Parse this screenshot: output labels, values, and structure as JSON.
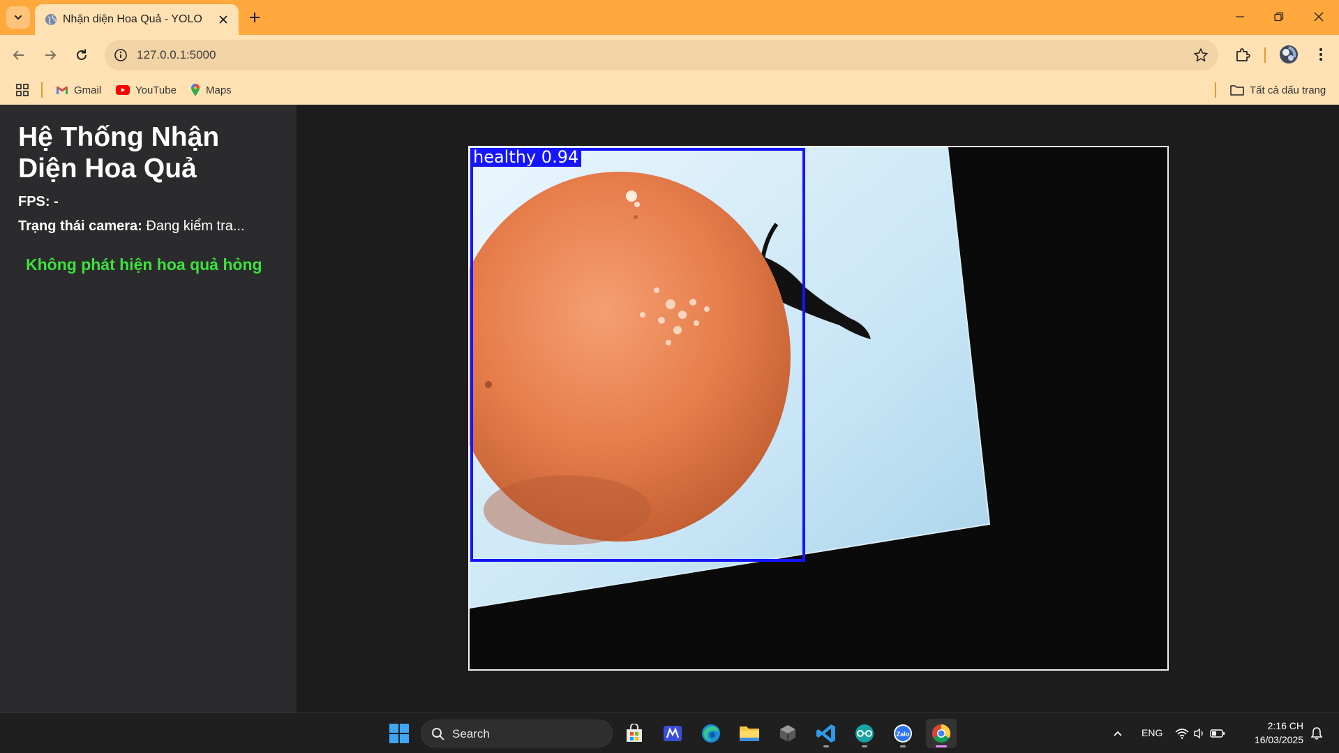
{
  "browser": {
    "tab": {
      "title": "Nhận diện Hoa Quả - YOLO"
    },
    "url": "127.0.0.1:5000",
    "bookmarks": [
      {
        "label": "Gmail",
        "icon": "gmail-icon"
      },
      {
        "label": "YouTube",
        "icon": "youtube-icon"
      },
      {
        "label": "Maps",
        "icon": "maps-icon"
      }
    ],
    "all_bookmarks_label": "Tất cả dấu trang",
    "titlebar_color": "#ffa83d",
    "toolbar_color": "#ffe1b3"
  },
  "app": {
    "title": "Hệ Thống Nhận Diện Hoa Quả",
    "fps_label": "FPS:",
    "fps_value": "-",
    "camera_label": "Trạng thái camera:",
    "camera_value": "Đang kiểm tra...",
    "status_message": "Không phát hiện hoa quả hỏng",
    "status_color": "#3be23b"
  },
  "detection": {
    "label": "healthy 0.94",
    "box_color": "#1515ff"
  },
  "taskbar": {
    "search_label": "Search",
    "language": "ENG",
    "time": "2:16 CH",
    "date": "16/03/2025"
  }
}
